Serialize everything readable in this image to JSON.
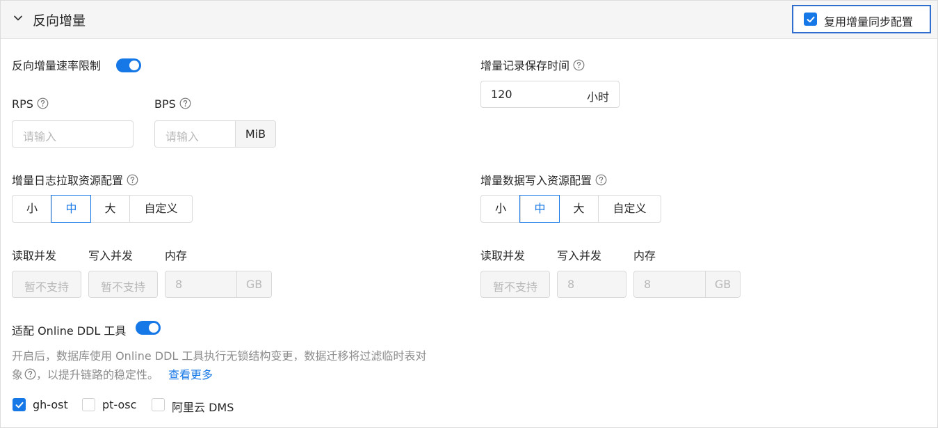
{
  "header": {
    "title": "反向增量",
    "reuse_label": "复用增量同步配置",
    "reuse_checked": true
  },
  "rate_limit": {
    "label": "反向增量速率限制",
    "enabled": true,
    "rps_label": "RPS",
    "rps_placeholder": "请输入",
    "bps_label": "BPS",
    "bps_placeholder": "请输入",
    "bps_unit": "MiB"
  },
  "retention": {
    "label": "增量记录保存时间",
    "value": "120",
    "unit": "小时"
  },
  "pull_resources": {
    "label": "增量日志拉取资源配置",
    "options": [
      "小",
      "中",
      "大",
      "自定义"
    ],
    "selected": "中",
    "read_label": "读取并发",
    "write_label": "写入并发",
    "memory_label": "内存",
    "read_value": "暂不支持",
    "write_value": "暂不支持",
    "memory_value": "8",
    "memory_unit": "GB"
  },
  "write_resources": {
    "label": "增量数据写入资源配置",
    "options": [
      "小",
      "中",
      "大",
      "自定义"
    ],
    "selected": "中",
    "read_label": "读取并发",
    "write_label": "写入并发",
    "memory_label": "内存",
    "read_value": "暂不支持",
    "write_value": "8",
    "memory_value": "8",
    "memory_unit": "GB"
  },
  "online_ddl": {
    "label": "适配 Online DDL 工具",
    "enabled": true,
    "description_line1": "开启后，数据库使用 Online DDL 工具执行无锁结构变更，数据迁移将过滤临时表对",
    "description_line2_prefix": "象",
    "description_line2_suffix": "，以提升链路的稳定性。",
    "learn_more": "查看更多",
    "tools": [
      {
        "label": "gh-ost",
        "checked": true
      },
      {
        "label": "pt-osc",
        "checked": false
      },
      {
        "label": "阿里云 DMS",
        "checked": false
      }
    ]
  },
  "colors": {
    "accent": "#1677e6",
    "header_bg": "#f5f5f5",
    "border": "#d9d9d9",
    "muted_text": "#8c8c8c"
  }
}
